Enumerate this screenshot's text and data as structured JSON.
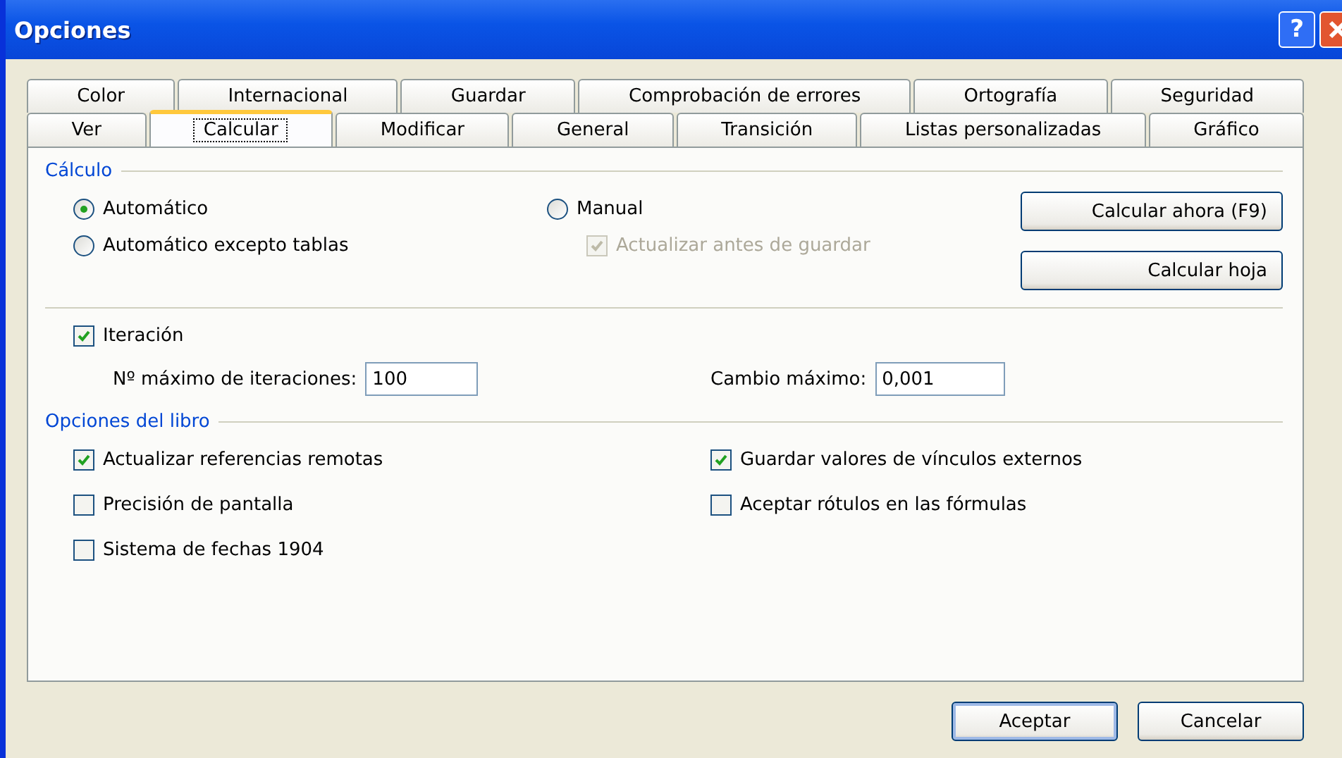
{
  "window": {
    "title": "Opciones",
    "help_label": "?"
  },
  "tab_rows": [
    [
      {
        "label": "Color",
        "selected": false
      },
      {
        "label": "Internacional",
        "selected": false
      },
      {
        "label": "Guardar",
        "selected": false
      },
      {
        "label": "Comprobación de errores",
        "selected": false
      },
      {
        "label": "Ortografía",
        "selected": false
      },
      {
        "label": "Seguridad",
        "selected": false
      }
    ],
    [
      {
        "label": "Ver",
        "selected": false
      },
      {
        "label": "Calcular",
        "selected": true
      },
      {
        "label": "Modificar",
        "selected": false
      },
      {
        "label": "General",
        "selected": false
      },
      {
        "label": "Transición",
        "selected": false
      },
      {
        "label": "Listas personalizadas",
        "selected": false
      },
      {
        "label": "Gráfico",
        "selected": false
      }
    ]
  ],
  "calculation": {
    "title": "Cálculo",
    "modes": [
      {
        "label": "Automático",
        "selected": true
      },
      {
        "label": "Automático excepto tablas",
        "selected": false
      },
      {
        "label": "Manual",
        "selected": false
      }
    ],
    "update_before_save": {
      "label": "Actualizar antes de guardar",
      "checked": true,
      "disabled": true
    },
    "buttons": [
      "Calcular ahora (F9)",
      "Calcular hoja"
    ]
  },
  "iteration": {
    "label": "Iteración",
    "checked": true,
    "max_iterations": {
      "label": "Nº máximo de iteraciones:",
      "value": "100"
    },
    "max_change": {
      "label": "Cambio máximo:",
      "value": "0,001"
    }
  },
  "workbook": {
    "title": "Opciones del libro",
    "options": [
      {
        "label": "Actualizar referencias remotas",
        "checked": true
      },
      {
        "label": "Guardar valores de vínculos externos",
        "checked": true
      },
      {
        "label": "Precisión de pantalla",
        "checked": false
      },
      {
        "label": "Aceptar rótulos en las fórmulas",
        "checked": false
      },
      {
        "label": "Sistema de fechas 1904",
        "checked": false
      }
    ]
  },
  "dialog_buttons": [
    "Aceptar",
    "Cancelar"
  ]
}
